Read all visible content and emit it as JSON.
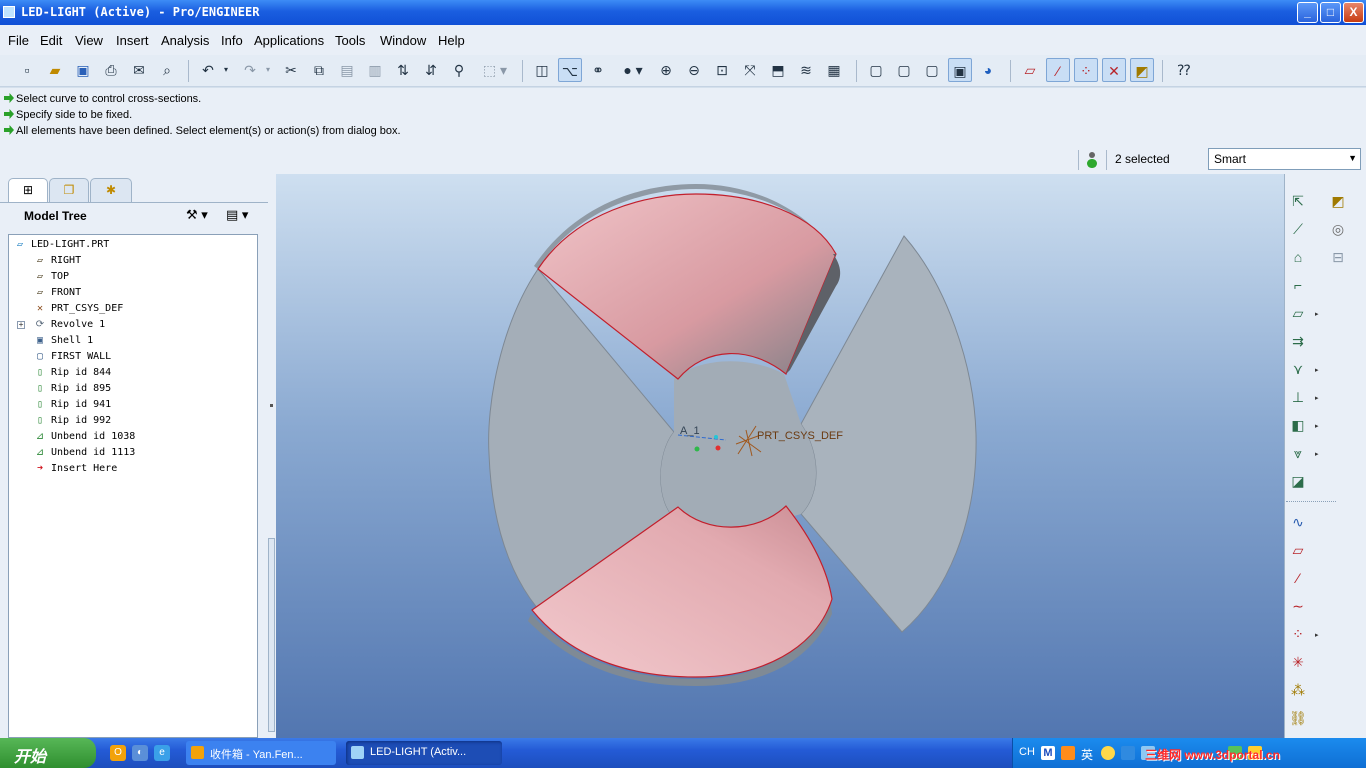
{
  "window": {
    "title": "LED-LIGHT (Active) - Pro/ENGINEER",
    "minimize": "_",
    "maximize": "□",
    "close": "X"
  },
  "menu": [
    "File",
    "Edit",
    "View",
    "Insert",
    "Analysis",
    "Info",
    "Applications",
    "Tools",
    "Window",
    "Help"
  ],
  "toolbar": {
    "icons": [
      "new-file-icon",
      "open-icon",
      "save-icon",
      "print-icon",
      "email-icon",
      "email-link-icon",
      "undo-icon",
      "redo-icon",
      "cut-icon",
      "copy-icon",
      "paste-icon",
      "paste-special-icon",
      "regenerate-icon",
      "regen-manager-icon",
      "find-icon",
      "select-box-icon",
      "sketch-icon",
      "network-icon",
      "saved-views-icon",
      "shading-icon",
      "zoom-in-icon",
      "zoom-out-icon",
      "refit-icon",
      "reorient-icon",
      "view-manager-icon",
      "layers-icon",
      "model-display-icon",
      "wireframe-icon",
      "hidden-line-icon",
      "no-hidden-icon",
      "shaded-icon",
      "enhanced-realism-icon",
      "datum-planes-icon",
      "datum-axes-icon",
      "datum-points-icon",
      "csys-display-icon",
      "annotation-display-icon",
      "whats-this-icon"
    ],
    "active": [
      "network-icon",
      "shaded-icon",
      "datum-axes-icon",
      "datum-points-icon",
      "csys-display-icon",
      "annotation-display-icon"
    ]
  },
  "messages": [
    "Select curve to control cross-sections.",
    "Specify side to be fixed.",
    "All elements have been defined. Select element(s) or action(s) from dialog box."
  ],
  "selection": {
    "count_text": "2 selected",
    "filter": "Smart"
  },
  "navigator": {
    "tabs": [
      "model-tree-tab",
      "folder-browser-tab",
      "favorites-tab"
    ],
    "title": "Model Tree",
    "items": [
      {
        "label": "LED-LIGHT.PRT",
        "icon": "part-icon",
        "level": 0
      },
      {
        "label": "RIGHT",
        "icon": "datum-plane-icon",
        "level": 1
      },
      {
        "label": "TOP",
        "icon": "datum-plane-icon",
        "level": 1
      },
      {
        "label": "FRONT",
        "icon": "datum-plane-icon",
        "level": 1
      },
      {
        "label": "PRT_CSYS_DEF",
        "icon": "csys-icon",
        "level": 1
      },
      {
        "label": "Revolve 1",
        "icon": "revolve-icon",
        "level": 1,
        "expandable": true
      },
      {
        "label": "Shell 1",
        "icon": "shell-icon",
        "level": 1
      },
      {
        "label": "FIRST WALL",
        "icon": "wall-icon",
        "level": 1
      },
      {
        "label": "Rip id 844",
        "icon": "rip-icon",
        "level": 1
      },
      {
        "label": "Rip id 895",
        "icon": "rip-icon",
        "level": 1
      },
      {
        "label": "Rip id 941",
        "icon": "rip-icon",
        "level": 1
      },
      {
        "label": "Rip id 992",
        "icon": "rip-icon",
        "level": 1
      },
      {
        "label": "Unbend id 1038",
        "icon": "unbend-icon",
        "level": 1
      },
      {
        "label": "Unbend id 1113",
        "icon": "unbend-icon",
        "level": 1
      },
      {
        "label": "Insert Here",
        "icon": "insert-here-icon",
        "level": 1
      }
    ]
  },
  "viewport": {
    "axis_label": "A_1",
    "csys_label": "PRT_CSYS_DEF"
  },
  "right_toolbar": [
    "sheetmetal-convert-icon",
    "wall-icon",
    "flat-wall-icon",
    "flange-wall-icon",
    "unattached-wall-icon",
    "extend-wall-icon",
    "rip-icon",
    "unbend-icon",
    "bend-back-icon",
    "flat-pattern-icon",
    "cut-icon",
    "datum-curve-tool-icon",
    "datum-plane-tool-icon",
    "datum-axis-tool-icon",
    "sketch-curve-icon",
    "datum-point-tool-icon",
    "csys-tool-icon",
    "analysis-icon",
    "chain-icon"
  ],
  "right_toolbar_2": [
    "annotation-icon",
    "layer-icon",
    "hierarchy-icon"
  ],
  "taskbar": {
    "start_label": "开始",
    "tasks": [
      {
        "label": "收件箱 - Yan.Fen...",
        "icon": "outlook-icon"
      },
      {
        "label": "LED-LIGHT (Activ...",
        "icon": "proe-icon"
      }
    ],
    "tray": {
      "lang": "CH",
      "ime": "英"
    },
    "watermark": "三维网 www.3dportal.cn"
  },
  "colors": {
    "surface_pink": "#e3a7ad",
    "surface_gray": "#a4aeb8",
    "edge_red": "#c21f2c",
    "viewport_top": "#cedff0",
    "viewport_bottom": "#5276b0"
  }
}
